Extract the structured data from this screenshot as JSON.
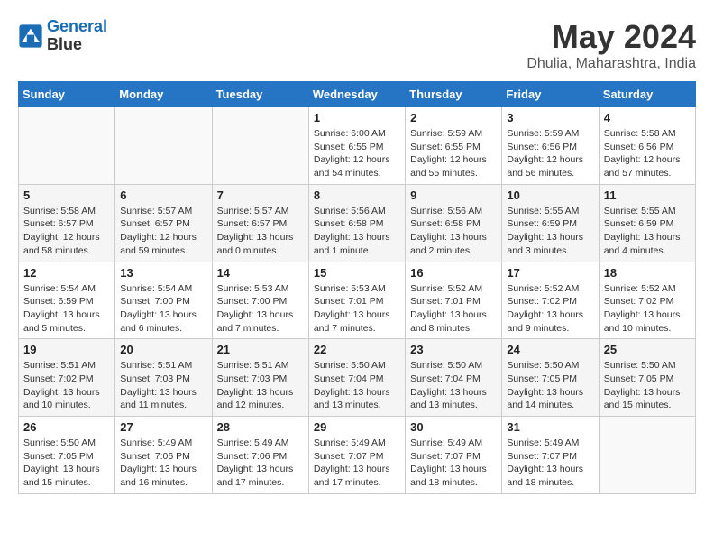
{
  "header": {
    "logo_line1": "General",
    "logo_line2": "Blue",
    "month_title": "May 2024",
    "location": "Dhulia, Maharashtra, India"
  },
  "weekdays": [
    "Sunday",
    "Monday",
    "Tuesday",
    "Wednesday",
    "Thursday",
    "Friday",
    "Saturday"
  ],
  "weeks": [
    [
      {
        "day": "",
        "info": ""
      },
      {
        "day": "",
        "info": ""
      },
      {
        "day": "",
        "info": ""
      },
      {
        "day": "1",
        "info": "Sunrise: 6:00 AM\nSunset: 6:55 PM\nDaylight: 12 hours\nand 54 minutes."
      },
      {
        "day": "2",
        "info": "Sunrise: 5:59 AM\nSunset: 6:55 PM\nDaylight: 12 hours\nand 55 minutes."
      },
      {
        "day": "3",
        "info": "Sunrise: 5:59 AM\nSunset: 6:56 PM\nDaylight: 12 hours\nand 56 minutes."
      },
      {
        "day": "4",
        "info": "Sunrise: 5:58 AM\nSunset: 6:56 PM\nDaylight: 12 hours\nand 57 minutes."
      }
    ],
    [
      {
        "day": "5",
        "info": "Sunrise: 5:58 AM\nSunset: 6:57 PM\nDaylight: 12 hours\nand 58 minutes."
      },
      {
        "day": "6",
        "info": "Sunrise: 5:57 AM\nSunset: 6:57 PM\nDaylight: 12 hours\nand 59 minutes."
      },
      {
        "day": "7",
        "info": "Sunrise: 5:57 AM\nSunset: 6:57 PM\nDaylight: 13 hours\nand 0 minutes."
      },
      {
        "day": "8",
        "info": "Sunrise: 5:56 AM\nSunset: 6:58 PM\nDaylight: 13 hours\nand 1 minute."
      },
      {
        "day": "9",
        "info": "Sunrise: 5:56 AM\nSunset: 6:58 PM\nDaylight: 13 hours\nand 2 minutes."
      },
      {
        "day": "10",
        "info": "Sunrise: 5:55 AM\nSunset: 6:59 PM\nDaylight: 13 hours\nand 3 minutes."
      },
      {
        "day": "11",
        "info": "Sunrise: 5:55 AM\nSunset: 6:59 PM\nDaylight: 13 hours\nand 4 minutes."
      }
    ],
    [
      {
        "day": "12",
        "info": "Sunrise: 5:54 AM\nSunset: 6:59 PM\nDaylight: 13 hours\nand 5 minutes."
      },
      {
        "day": "13",
        "info": "Sunrise: 5:54 AM\nSunset: 7:00 PM\nDaylight: 13 hours\nand 6 minutes."
      },
      {
        "day": "14",
        "info": "Sunrise: 5:53 AM\nSunset: 7:00 PM\nDaylight: 13 hours\nand 7 minutes."
      },
      {
        "day": "15",
        "info": "Sunrise: 5:53 AM\nSunset: 7:01 PM\nDaylight: 13 hours\nand 7 minutes."
      },
      {
        "day": "16",
        "info": "Sunrise: 5:52 AM\nSunset: 7:01 PM\nDaylight: 13 hours\nand 8 minutes."
      },
      {
        "day": "17",
        "info": "Sunrise: 5:52 AM\nSunset: 7:02 PM\nDaylight: 13 hours\nand 9 minutes."
      },
      {
        "day": "18",
        "info": "Sunrise: 5:52 AM\nSunset: 7:02 PM\nDaylight: 13 hours\nand 10 minutes."
      }
    ],
    [
      {
        "day": "19",
        "info": "Sunrise: 5:51 AM\nSunset: 7:02 PM\nDaylight: 13 hours\nand 10 minutes."
      },
      {
        "day": "20",
        "info": "Sunrise: 5:51 AM\nSunset: 7:03 PM\nDaylight: 13 hours\nand 11 minutes."
      },
      {
        "day": "21",
        "info": "Sunrise: 5:51 AM\nSunset: 7:03 PM\nDaylight: 13 hours\nand 12 minutes."
      },
      {
        "day": "22",
        "info": "Sunrise: 5:50 AM\nSunset: 7:04 PM\nDaylight: 13 hours\nand 13 minutes."
      },
      {
        "day": "23",
        "info": "Sunrise: 5:50 AM\nSunset: 7:04 PM\nDaylight: 13 hours\nand 13 minutes."
      },
      {
        "day": "24",
        "info": "Sunrise: 5:50 AM\nSunset: 7:05 PM\nDaylight: 13 hours\nand 14 minutes."
      },
      {
        "day": "25",
        "info": "Sunrise: 5:50 AM\nSunset: 7:05 PM\nDaylight: 13 hours\nand 15 minutes."
      }
    ],
    [
      {
        "day": "26",
        "info": "Sunrise: 5:50 AM\nSunset: 7:05 PM\nDaylight: 13 hours\nand 15 minutes."
      },
      {
        "day": "27",
        "info": "Sunrise: 5:49 AM\nSunset: 7:06 PM\nDaylight: 13 hours\nand 16 minutes."
      },
      {
        "day": "28",
        "info": "Sunrise: 5:49 AM\nSunset: 7:06 PM\nDaylight: 13 hours\nand 17 minutes."
      },
      {
        "day": "29",
        "info": "Sunrise: 5:49 AM\nSunset: 7:07 PM\nDaylight: 13 hours\nand 17 minutes."
      },
      {
        "day": "30",
        "info": "Sunrise: 5:49 AM\nSunset: 7:07 PM\nDaylight: 13 hours\nand 18 minutes."
      },
      {
        "day": "31",
        "info": "Sunrise: 5:49 AM\nSunset: 7:07 PM\nDaylight: 13 hours\nand 18 minutes."
      },
      {
        "day": "",
        "info": ""
      }
    ]
  ]
}
